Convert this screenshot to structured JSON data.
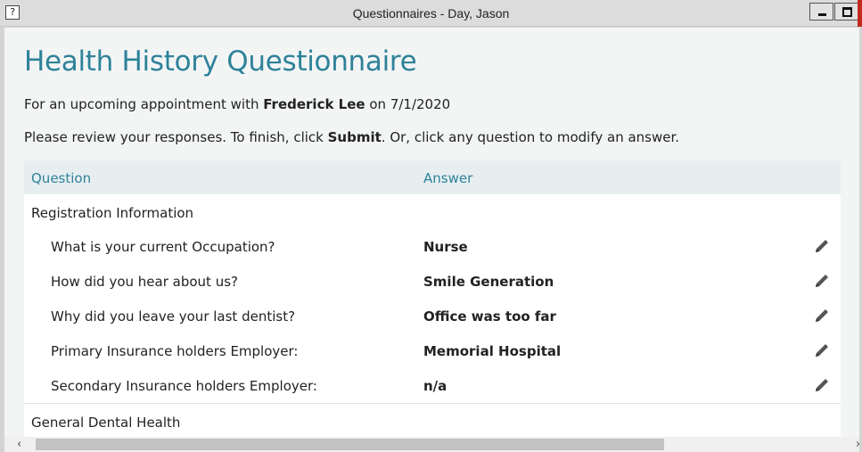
{
  "window": {
    "title": "Questionnaires - Day, Jason",
    "app_icon": "questionnaire-app-icon",
    "controls": [
      "minimize-icon",
      "maximize-icon"
    ]
  },
  "page": {
    "heading": "Health History Questionnaire",
    "appointment": {
      "prefix": "For an upcoming appointment with ",
      "provider": "Frederick Lee",
      "middle": " on ",
      "date": "7/1/2020"
    },
    "instructions": {
      "prefix": "Please review your responses. To finish, click ",
      "action": "Submit",
      "suffix": ". Or, click any question to modify an answer."
    }
  },
  "table": {
    "columns": {
      "question": "Question",
      "answer": "Answer"
    },
    "sections": [
      {
        "title": "Registration Information",
        "rows": [
          {
            "question": "What is your current Occupation?",
            "answer": "Nurse"
          },
          {
            "question": "How did you hear about us?",
            "answer": "Smile Generation"
          },
          {
            "question": "Why did you leave your last dentist?",
            "answer": "Office was too far"
          },
          {
            "question": "Primary Insurance holders Employer:",
            "answer": "Memorial Hospital"
          },
          {
            "question": "Secondary Insurance holders Employer:",
            "answer": "n/a"
          }
        ]
      },
      {
        "title": "General Dental Health",
        "rows": []
      }
    ],
    "edit_icon": "pencil-icon"
  },
  "colors": {
    "accent": "#2e8299",
    "header_bg": "#e6eef0",
    "page_bg": "#f3f5f5",
    "close_accent": "#c42b1c"
  }
}
